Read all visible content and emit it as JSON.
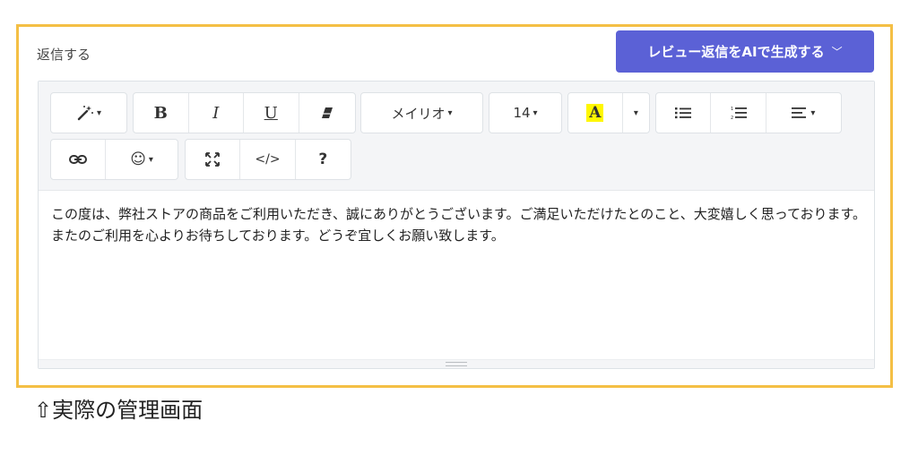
{
  "header": {
    "reply_label": "返信する",
    "ai_button_label": "レビュー返信をAIで生成する",
    "ai_button_chevron": "﹀"
  },
  "toolbar": {
    "magic_caret": "▾",
    "bold": "B",
    "italic": "I",
    "underline": "U",
    "font_family": "メイリオ",
    "font_size": "14",
    "color_letter": "A",
    "dropdown_caret": "▾",
    "emoji_glyph": "☺",
    "code_label": "</>",
    "help_label": "?"
  },
  "editor": {
    "content": "この度は、弊社ストアの商品をご利用いただき、誠にありがとうございます。ご満足いただけたとのこと、大変嬉しく思っております。またのご利用を心よりお待ちしております。どうぞ宜しくお願い致します。"
  },
  "caption": "⇧実際の管理画面",
  "colors": {
    "frame_border": "#f4bf45",
    "ai_button_bg": "#5b61d6",
    "text_highlight": "#fff700"
  }
}
